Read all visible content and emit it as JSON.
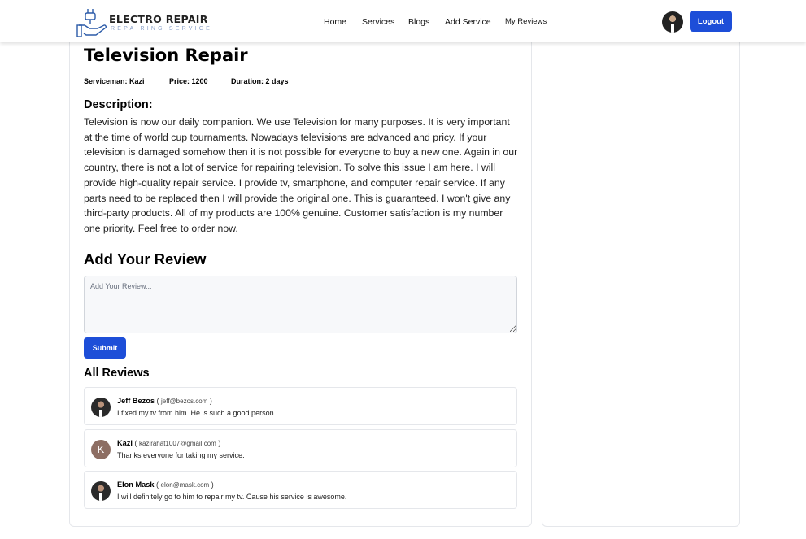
{
  "brand": {
    "title": "ELECTRO REPAIR",
    "subtitle": "REPAIRING SERVICE",
    "accent": "#1d4ed8"
  },
  "nav": {
    "items": [
      {
        "label": "Home"
      },
      {
        "label": "Services"
      },
      {
        "label": "Blogs"
      },
      {
        "label": "Add Service"
      },
      {
        "label": "My Reviews"
      }
    ],
    "logout_label": "Logout"
  },
  "service": {
    "title": "Television Repair",
    "serviceman": "Serviceman: Kazi",
    "price": "Price: 1200",
    "duration": "Duration: 2 days",
    "description_heading": "Description:",
    "description": "Television is now our daily companion. We use Television for many purposes. It is very important at the time of world cup tournaments. Nowadays televisions are advanced and pricy. If your television is damaged somehow then it is not possible for everyone to buy a new one. Again in our country, there is not a lot of service for repairing television. To solve this issue I am here. I will provide high-quality repair service. I provide tv, smartphone, and computer repair service. If any parts need to be replaced then I will provide the original one. This is guaranteed. I won't give any third-party products. All of my products are 100% genuine. Customer satisfaction is my number one priority. Feel free to order now."
  },
  "review_form": {
    "heading": "Add Your Review",
    "placeholder": "Add Your Review...",
    "submit_label": "Submit"
  },
  "reviews": {
    "heading": "All Reviews",
    "items": [
      {
        "name": "Jeff Bezos",
        "email": "jeff@bezos.com",
        "text": "I fixed my tv from him. He is such a good person",
        "avatar": "photo"
      },
      {
        "name": "Kazi",
        "email": "kazirahat1007@gmail.com",
        "text": "Thanks everyone for taking my service.",
        "avatar": "K"
      },
      {
        "name": "Elon Mask",
        "email": "elon@mask.com",
        "text": "I will definitely go to him to repair my tv. Cause his service is awesome.",
        "avatar": "photo"
      }
    ]
  }
}
